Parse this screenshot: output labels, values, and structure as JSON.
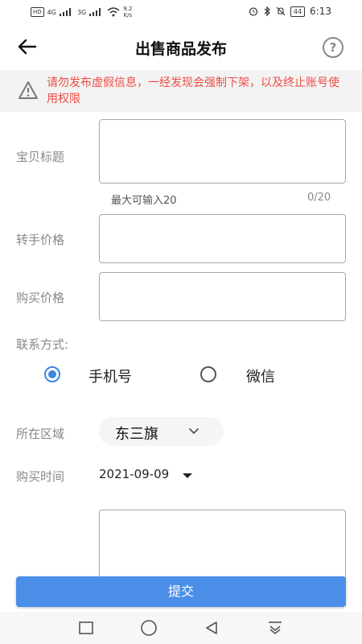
{
  "status_bar": {
    "hd_badge": "HD",
    "net1": "4G",
    "net2": "3G",
    "speed_value": "9.2",
    "speed_unit": "K/s",
    "battery": "44",
    "time": "6:13"
  },
  "header": {
    "title": "出售商品发布",
    "help_symbol": "?"
  },
  "notice": {
    "text": "请勿发布虚假信息，一经发现会强制下架，以及终止账号使用权限"
  },
  "form": {
    "title_label": "宝贝标题",
    "title_value": "",
    "title_hint": "最大可输入20",
    "title_count": "0/20",
    "resale_price_label": "转手价格",
    "resale_price_value": "",
    "purchase_price_label": "购买价格",
    "purchase_price_value": "",
    "contact_label": "联系方式:",
    "contact_options": [
      {
        "label": "手机号",
        "selected": true
      },
      {
        "label": "微信",
        "selected": false
      }
    ],
    "region_label": "所在区域",
    "region_value": "东三旗",
    "purchase_time_label": "购买时间",
    "purchase_time_value": "2021-09-09",
    "description_value": ""
  },
  "submit_label": "提交",
  "colors": {
    "accent": "#3a86e6",
    "submit": "#4a8ee8",
    "warning_text": "#ef4d45"
  },
  "icons": {
    "back": "arrow-left-icon",
    "help": "question-circle-icon",
    "warning": "warning-triangle-icon",
    "region": "chevron-down-icon",
    "date": "caret-down-icon",
    "nav": [
      "square-icon",
      "circle-icon",
      "triangle-back-icon",
      "download-icon"
    ]
  }
}
